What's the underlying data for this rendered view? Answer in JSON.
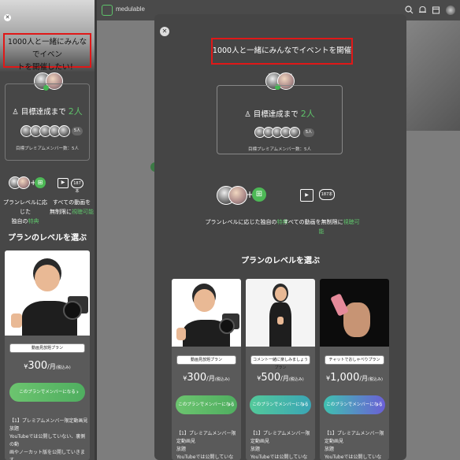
{
  "background_page": {
    "logo_text": "medulable",
    "header_icons": [
      "search-icon",
      "bell-icon",
      "calendar-icon",
      "avatar"
    ]
  },
  "campaign": {
    "title": "1000人と一緒にみんなでイベントを開催したい！",
    "title_mobile_line1": "1000人と一緒にみんなでイベン",
    "title_mobile_line2": "トを開催したい！",
    "goal_prefix": "目標達成まで",
    "goal_number": "2人",
    "member_count_badge": "5人",
    "members_sub": "目標プレミアムメンバー数：5人"
  },
  "perks": {
    "perk1_line1": "プランレベルに応じた",
    "perk1_line2_prefix": "独自の",
    "perk1_highlight": "特典",
    "perk1_full_prefix": "プランレベルに応じた独自の",
    "perk2_line1": "すべての動画を",
    "perk2_line2_prefix": "無制限に",
    "perk2_highlight": "視聴可能",
    "perk2_full_prefix": "すべての動画を無制限に",
    "video_count": "187本"
  },
  "plans_heading": "プランのレベルを選ぶ",
  "plans": [
    {
      "name": "動画見放題プラン",
      "currency": "¥",
      "price": "300",
      "per": "/月",
      "tax": "(税込み)",
      "button": "このプランでメンバーになる",
      "desc_line1": "【1】プレミアムメンバー限定動画見",
      "desc_line2": "放題",
      "desc_line3": "YouTubeでは公開していない、",
      "mobile_desc_line1": "【1】プレミアムメンバー限定動画見放題",
      "mobile_desc_line2": "YouTubeでは公開していない、裏側の動",
      "mobile_desc_line3": "画やノーカット版を公開していきます。",
      "accent": "#5ec26a"
    },
    {
      "name": "コメント一緒に楽しみましょうプラン",
      "currency": "¥",
      "price": "500",
      "per": "/月",
      "tax": "(税込み)",
      "button": "このプランでメンバーになる",
      "desc_line1": "【1】プレミアムメンバー限定動画見",
      "desc_line2": "放題",
      "desc_line3": "YouTubeでは公開していない、",
      "accent": "#3fb7a0"
    },
    {
      "name": "チャットでおしゃべりプラン",
      "currency": "¥",
      "price": "1,000",
      "per": "/月",
      "tax": "(税込み)",
      "button": "このプランでメンバーになる",
      "desc_line1": "【1】プレミアムメンバー限定動画見",
      "desc_line2": "放題",
      "desc_line3": "YouTubeでは公開していない、",
      "accent": "#6b5fd6"
    }
  ],
  "colors": {
    "highlight_box": "#e01818",
    "green": "#5ec26a",
    "modal_bg": "#454545"
  }
}
